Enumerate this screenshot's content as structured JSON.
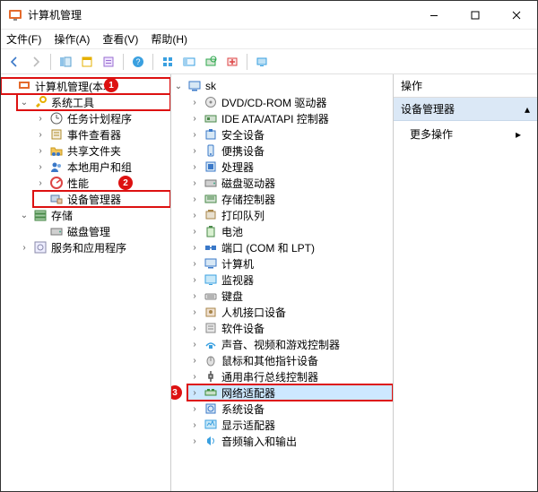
{
  "window": {
    "title": "计算机管理"
  },
  "menu": {
    "file": "文件(F)",
    "action": "操作(A)",
    "view": "查看(V)",
    "help": "帮助(H)"
  },
  "left_tree": {
    "root": "计算机管理(本地",
    "system_tools": "系统工具",
    "task_scheduler": "任务计划程序",
    "event_viewer": "事件查看器",
    "shared_folders": "共享文件夹",
    "local_users": "本地用户和组",
    "performance": "性能",
    "device_manager": "设备管理器",
    "storage": "存储",
    "disk_management": "磁盘管理",
    "services_apps": "服务和应用程序"
  },
  "device_tree": {
    "root": "sk",
    "items": [
      "DVD/CD-ROM 驱动器",
      "IDE ATA/ATAPI 控制器",
      "安全设备",
      "便携设备",
      "处理器",
      "磁盘驱动器",
      "存储控制器",
      "打印队列",
      "电池",
      "端口 (COM 和 LPT)",
      "计算机",
      "监视器",
      "键盘",
      "人机接口设备",
      "软件设备",
      "声音、视频和游戏控制器",
      "鼠标和其他指针设备",
      "通用串行总线控制器",
      "网络适配器",
      "系统设备",
      "显示适配器",
      "音频输入和输出"
    ]
  },
  "right": {
    "header": "操作",
    "section": "设备管理器",
    "more": "更多操作"
  },
  "badges": {
    "b1": "1",
    "b2": "2",
    "b3": "3"
  }
}
